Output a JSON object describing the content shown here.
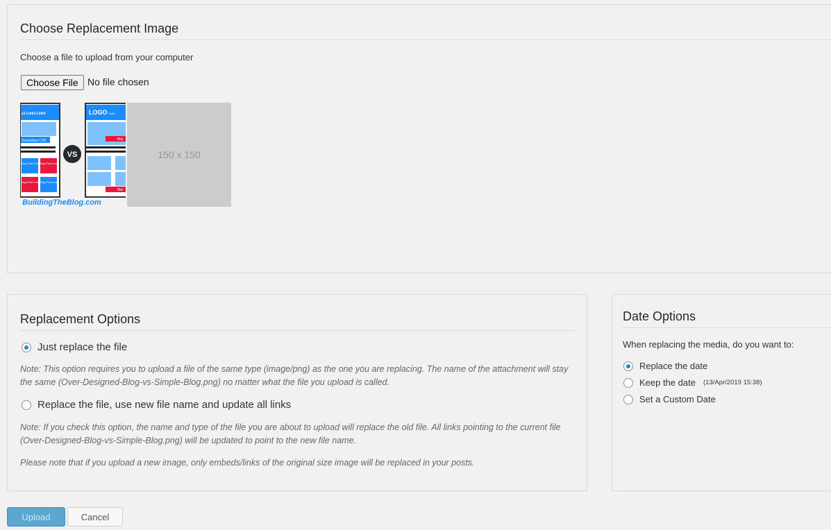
{
  "replacement_image": {
    "title": "Choose Replacement Image",
    "description": "Choose a file to upload from your computer",
    "file_button": "Choose File",
    "file_status": "No file chosen",
    "placeholder_text": "150 x 150",
    "thumbnail": {
      "nav_left": "s1  Link3  Link4",
      "nav_right_logo": "LOGO",
      "nav_right_link": "Link1",
      "cta": "Secondary CTA",
      "tile_text": "Blog Post Link",
      "vs": "VS",
      "mini_cta": "Mai",
      "brand": "BuildingTheBlog.com"
    }
  },
  "replacement_options": {
    "title": "Replacement Options",
    "option1_label": "Just replace the file",
    "option1_note": "Note: This option requires you to upload a file of the same type (image/png) as the one you are replacing. The name of the attachment will stay the same (Over-Designed-Blog-vs-Simple-Blog.png) no matter what the file you upload is called.",
    "option2_label": "Replace the file, use new file name and update all links",
    "option2_note": "Note: If you check this option, the name and type of the file you are about to upload will replace the old file. All links pointing to the current file (Over-Designed-Blog-vs-Simple-Blog.png) will be updated to point to the new file name.",
    "embed_note": "Please note that if you upload a new image, only embeds/links of the original size image will be replaced in your posts.",
    "selected": "option1"
  },
  "date_options": {
    "title": "Date Options",
    "question": "When replacing the media, do you want to:",
    "options": [
      {
        "label": "Replace the date",
        "checked": true
      },
      {
        "label": "Keep the date",
        "extra": "(13/Apr/2019 15:38)",
        "checked": false
      },
      {
        "label": "Set a Custom Date",
        "checked": false
      }
    ]
  },
  "actions": {
    "upload": "Upload",
    "cancel": "Cancel"
  },
  "colors": {
    "background": "#f1f1f1",
    "primary_button": "#5ba7cf",
    "radio_accent": "#1e8cbe",
    "thumb_blue": "#1a8cff",
    "thumb_red": "#e8193c"
  }
}
